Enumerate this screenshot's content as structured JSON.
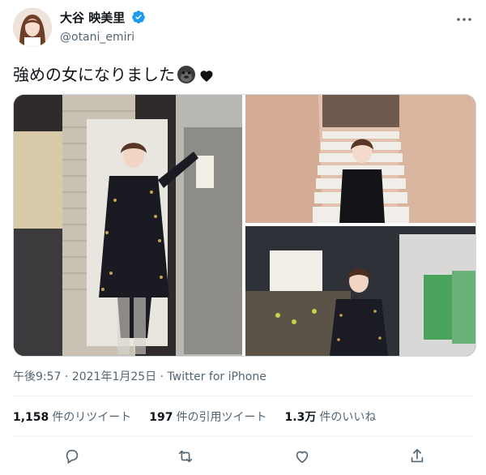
{
  "user": {
    "display_name": "大谷 映美里",
    "handle": "@otani_emiri",
    "verified": true,
    "verified_color": "#1d9bf0"
  },
  "tweet": {
    "text": "強めの女になりました",
    "emojis": [
      "gorilla-emoji",
      "black-heart-emoji"
    ]
  },
  "meta": {
    "time": "午後9:57",
    "separator": "·",
    "date": "2021年1月25日",
    "source": "Twitter for iPhone"
  },
  "stats": [
    {
      "count": "1,158",
      "label": "件のリツイート"
    },
    {
      "count": "197",
      "label": "件の引用ツイート"
    },
    {
      "count": "1.3万",
      "label": "件のいいね"
    }
  ],
  "actions": [
    "reply-icon",
    "retweet-icon",
    "like-icon",
    "share-icon"
  ],
  "colors": {
    "text": "#0f1419",
    "secondary": "#536471",
    "divider": "#eff3f4"
  }
}
